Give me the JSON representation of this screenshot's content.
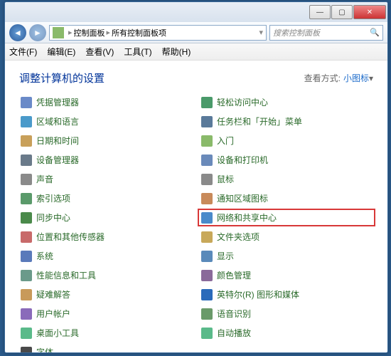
{
  "window": {
    "minimize": "—",
    "maximize": "▢",
    "close": "✕"
  },
  "nav": {
    "back": "◄",
    "forward": "►"
  },
  "breadcrumb": {
    "p1": "控制面板",
    "p2": "所有控制面板项",
    "sep": "▸",
    "dd": "▾"
  },
  "search": {
    "placeholder": "搜索控制面板",
    "icon": "🔍"
  },
  "menu": {
    "file": "文件(F)",
    "edit": "编辑(E)",
    "view": "查看(V)",
    "tools": "工具(T)",
    "help": "帮助(H)"
  },
  "heading": "调整计算机的设置",
  "viewby_label": "查看方式:",
  "viewby_value": "小图标",
  "items": {
    "l0": "凭据管理器",
    "r0": "轻松访问中心",
    "l1": "区域和语言",
    "r1": "任务栏和「开始」菜单",
    "l2": "日期和时间",
    "r2": "入门",
    "l3": "设备管理器",
    "r3": "设备和打印机",
    "l4": "声音",
    "r4": "鼠标",
    "l5": "索引选项",
    "r5": "通知区域图标",
    "l6": "同步中心",
    "r6": "网络和共享中心",
    "l7": "位置和其他传感器",
    "r7": "文件夹选项",
    "l8": "系统",
    "r8": "显示",
    "l9": "性能信息和工具",
    "r9": "颜色管理",
    "l10": "疑难解答",
    "r10": "英特尔(R) 图形和媒体",
    "l11": "用户帐户",
    "r11": "语音识别",
    "l12": "桌面小工具",
    "r12": "自动播放",
    "l13": "字体"
  },
  "colors": {
    "ic": [
      "#6a8ac8",
      "#4a9aca",
      "#c8a05a",
      "#6a7a8a",
      "#8a8a8a",
      "#5a9a6a",
      "#4a8a4a",
      "#c86a6a",
      "#5a7aba",
      "#6a9a8a",
      "#c89a5a",
      "#8a6aba",
      "#5aba8a",
      "#4a4a4a"
    ],
    "icr": [
      "#4a9a6a",
      "#5a7a9a",
      "#8aba6a",
      "#6a8aba",
      "#8a8a8a",
      "#c88a5a",
      "#4a8aca",
      "#c8a85a",
      "#5a8aba",
      "#8a6a9a",
      "#2a6aba",
      "#6a9a6a",
      "#5aba8a"
    ]
  }
}
